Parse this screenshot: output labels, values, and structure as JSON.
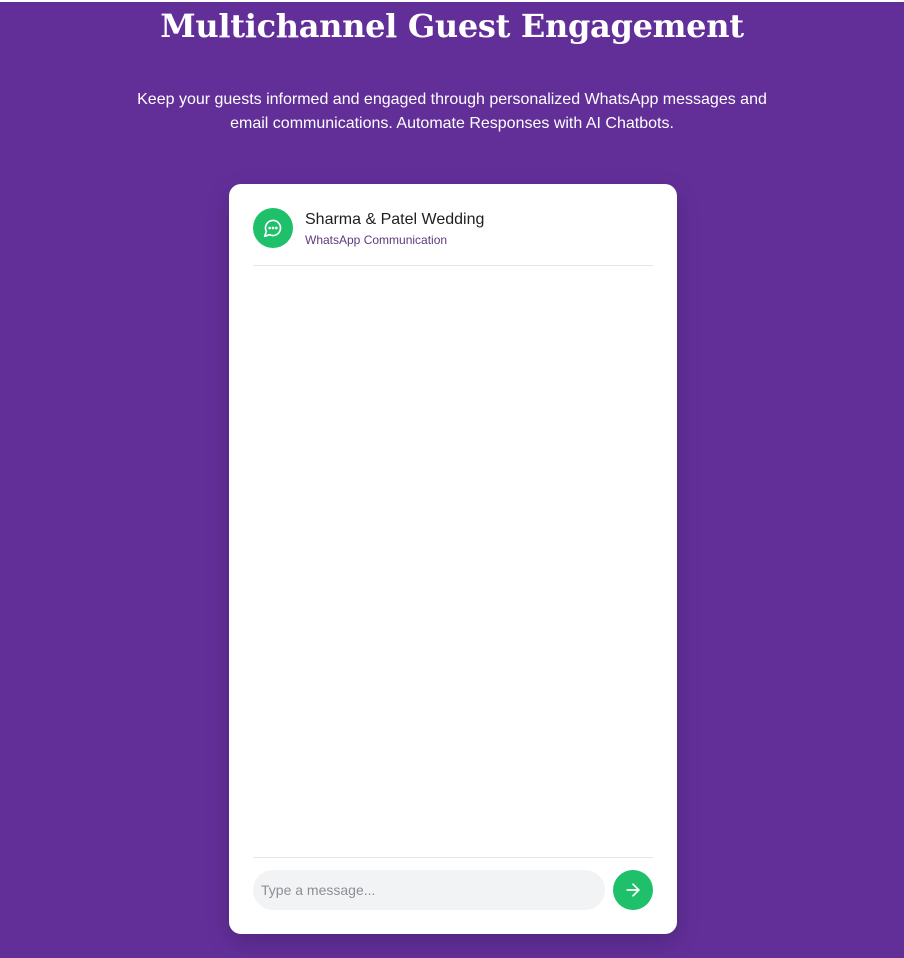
{
  "hero": {
    "title": "Multichannel Guest Engagement",
    "subtitle_line1": "Keep your guests informed and engaged through personalized WhatsApp messages and",
    "subtitle_line2": "email communications. Automate Responses with AI Chatbots."
  },
  "chat": {
    "avatar_icon": "message-circle-icon",
    "title": "Sharma & Patel Wedding",
    "subtitle": "WhatsApp Communication",
    "messages": []
  },
  "composer": {
    "placeholder": "Type a message...",
    "value": "",
    "send_icon": "arrow-right-icon"
  },
  "colors": {
    "background": "#622f99",
    "accent_green": "#1fc06a",
    "card": "#ffffff",
    "input_bg": "#f2f3f5"
  }
}
